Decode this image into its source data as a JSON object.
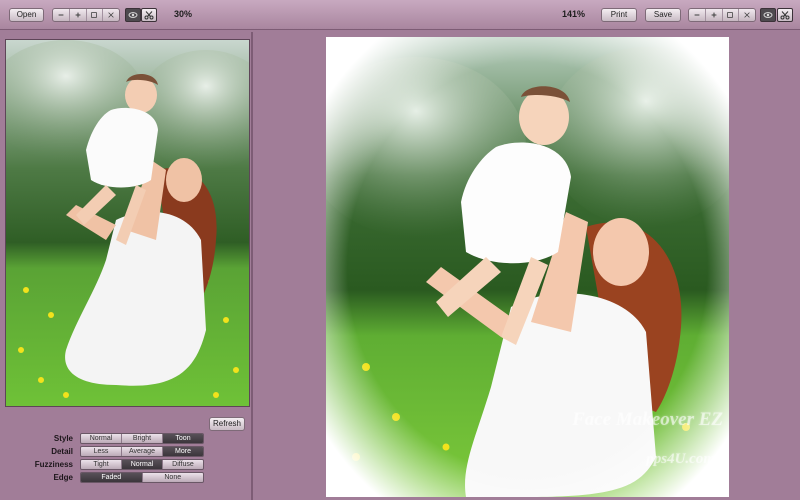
{
  "toolbar": {
    "open_label": "Open",
    "left_zoom_pct": "30%",
    "right_zoom_pct": "141%",
    "print_label": "Print",
    "save_label": "Save"
  },
  "left_pane": {
    "refresh_label": "Refresh",
    "controls": {
      "style": {
        "label": "Style",
        "options": [
          "Normal",
          "Bright",
          "Toon"
        ],
        "selected": "Toon"
      },
      "detail": {
        "label": "Detail",
        "options": [
          "Less",
          "Average",
          "More"
        ],
        "selected": "More"
      },
      "fuzziness": {
        "label": "Fuzziness",
        "options": [
          "Tight",
          "Normal",
          "Diffuse"
        ],
        "selected": "Normal"
      },
      "edge": {
        "label": "Edge",
        "options": [
          "Faded",
          "None"
        ],
        "selected": "Faded"
      }
    }
  },
  "right_pane": {
    "watermark_line1": "Face Makeover EZ",
    "watermark_line2": "pps4U.com"
  },
  "colors": {
    "background": "#a17d98",
    "selected_segment": "#4a444a"
  }
}
